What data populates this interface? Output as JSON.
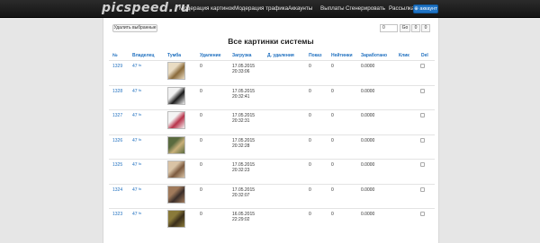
{
  "nav": {
    "brand": "picspeed.ru",
    "items": [
      "Модерация картинок",
      "Модерация трафика",
      "Аккаунты",
      "Выплаты",
      "Сгенерировать",
      "Рассылка"
    ],
    "account_label": "⊕ аккаунт"
  },
  "toolbar": {
    "delete_label": "Удалить выбранные",
    "page_value": "0",
    "pager_buttons": [
      "Go",
      "0",
      "0"
    ]
  },
  "title": "Все картинки системы",
  "columns": [
    "№",
    "Владелец",
    "Тумба",
    "Удаление",
    "Загрузка",
    "Д. удаления",
    "Показ",
    "Нейтинки",
    "Заработано",
    "Клик",
    "Del"
  ],
  "rows": [
    {
      "id": "1329",
      "owner": "47",
      "owner_sup": "9с",
      "deletion": "0",
      "date": "17.05.2015",
      "time": "20:33:06",
      "views": "0",
      "ratings": "0",
      "earned": "0.0000",
      "thumb_colors": [
        "#e9dcc3",
        "#8a6a3a"
      ]
    },
    {
      "id": "1328",
      "owner": "47",
      "owner_sup": "9с",
      "deletion": "0",
      "date": "17.05.2015",
      "time": "20:32:41",
      "views": "0",
      "ratings": "0",
      "earned": "0.0000",
      "thumb_colors": [
        "#f1f1f1",
        "#1a1a1a"
      ]
    },
    {
      "id": "1327",
      "owner": "47",
      "owner_sup": "9с",
      "deletion": "0",
      "date": "17.05.2015",
      "time": "20:32:31",
      "views": "0",
      "ratings": "0",
      "earned": "0.0000",
      "thumb_colors": [
        "#f4f4f4",
        "#b8334a"
      ]
    },
    {
      "id": "1326",
      "owner": "47",
      "owner_sup": "9с",
      "deletion": "0",
      "date": "17.05.2015",
      "time": "20:32:28",
      "views": "0",
      "ratings": "0",
      "earned": "0.0000",
      "thumb_colors": [
        "#5a6b3f",
        "#c9b07a"
      ]
    },
    {
      "id": "1325",
      "owner": "47",
      "owner_sup": "9с",
      "deletion": "0",
      "date": "17.05.2015",
      "time": "20:32:23",
      "views": "0",
      "ratings": "0",
      "earned": "0.0000",
      "thumb_colors": [
        "#d9c3a5",
        "#7c5a3f"
      ]
    },
    {
      "id": "1324",
      "owner": "47",
      "owner_sup": "9с",
      "deletion": "0",
      "date": "17.05.2015",
      "time": "20:32:07",
      "views": "0",
      "ratings": "0",
      "earned": "0.0000",
      "thumb_colors": [
        "#a07a5b",
        "#3b2f2a"
      ]
    },
    {
      "id": "1323",
      "owner": "47",
      "owner_sup": "9с",
      "deletion": "0",
      "date": "16.05.2015",
      "time": "22:29:02",
      "views": "0",
      "ratings": "0",
      "earned": "0.0000",
      "thumb_colors": [
        "#8a7a3a",
        "#3a2e1a"
      ]
    }
  ]
}
